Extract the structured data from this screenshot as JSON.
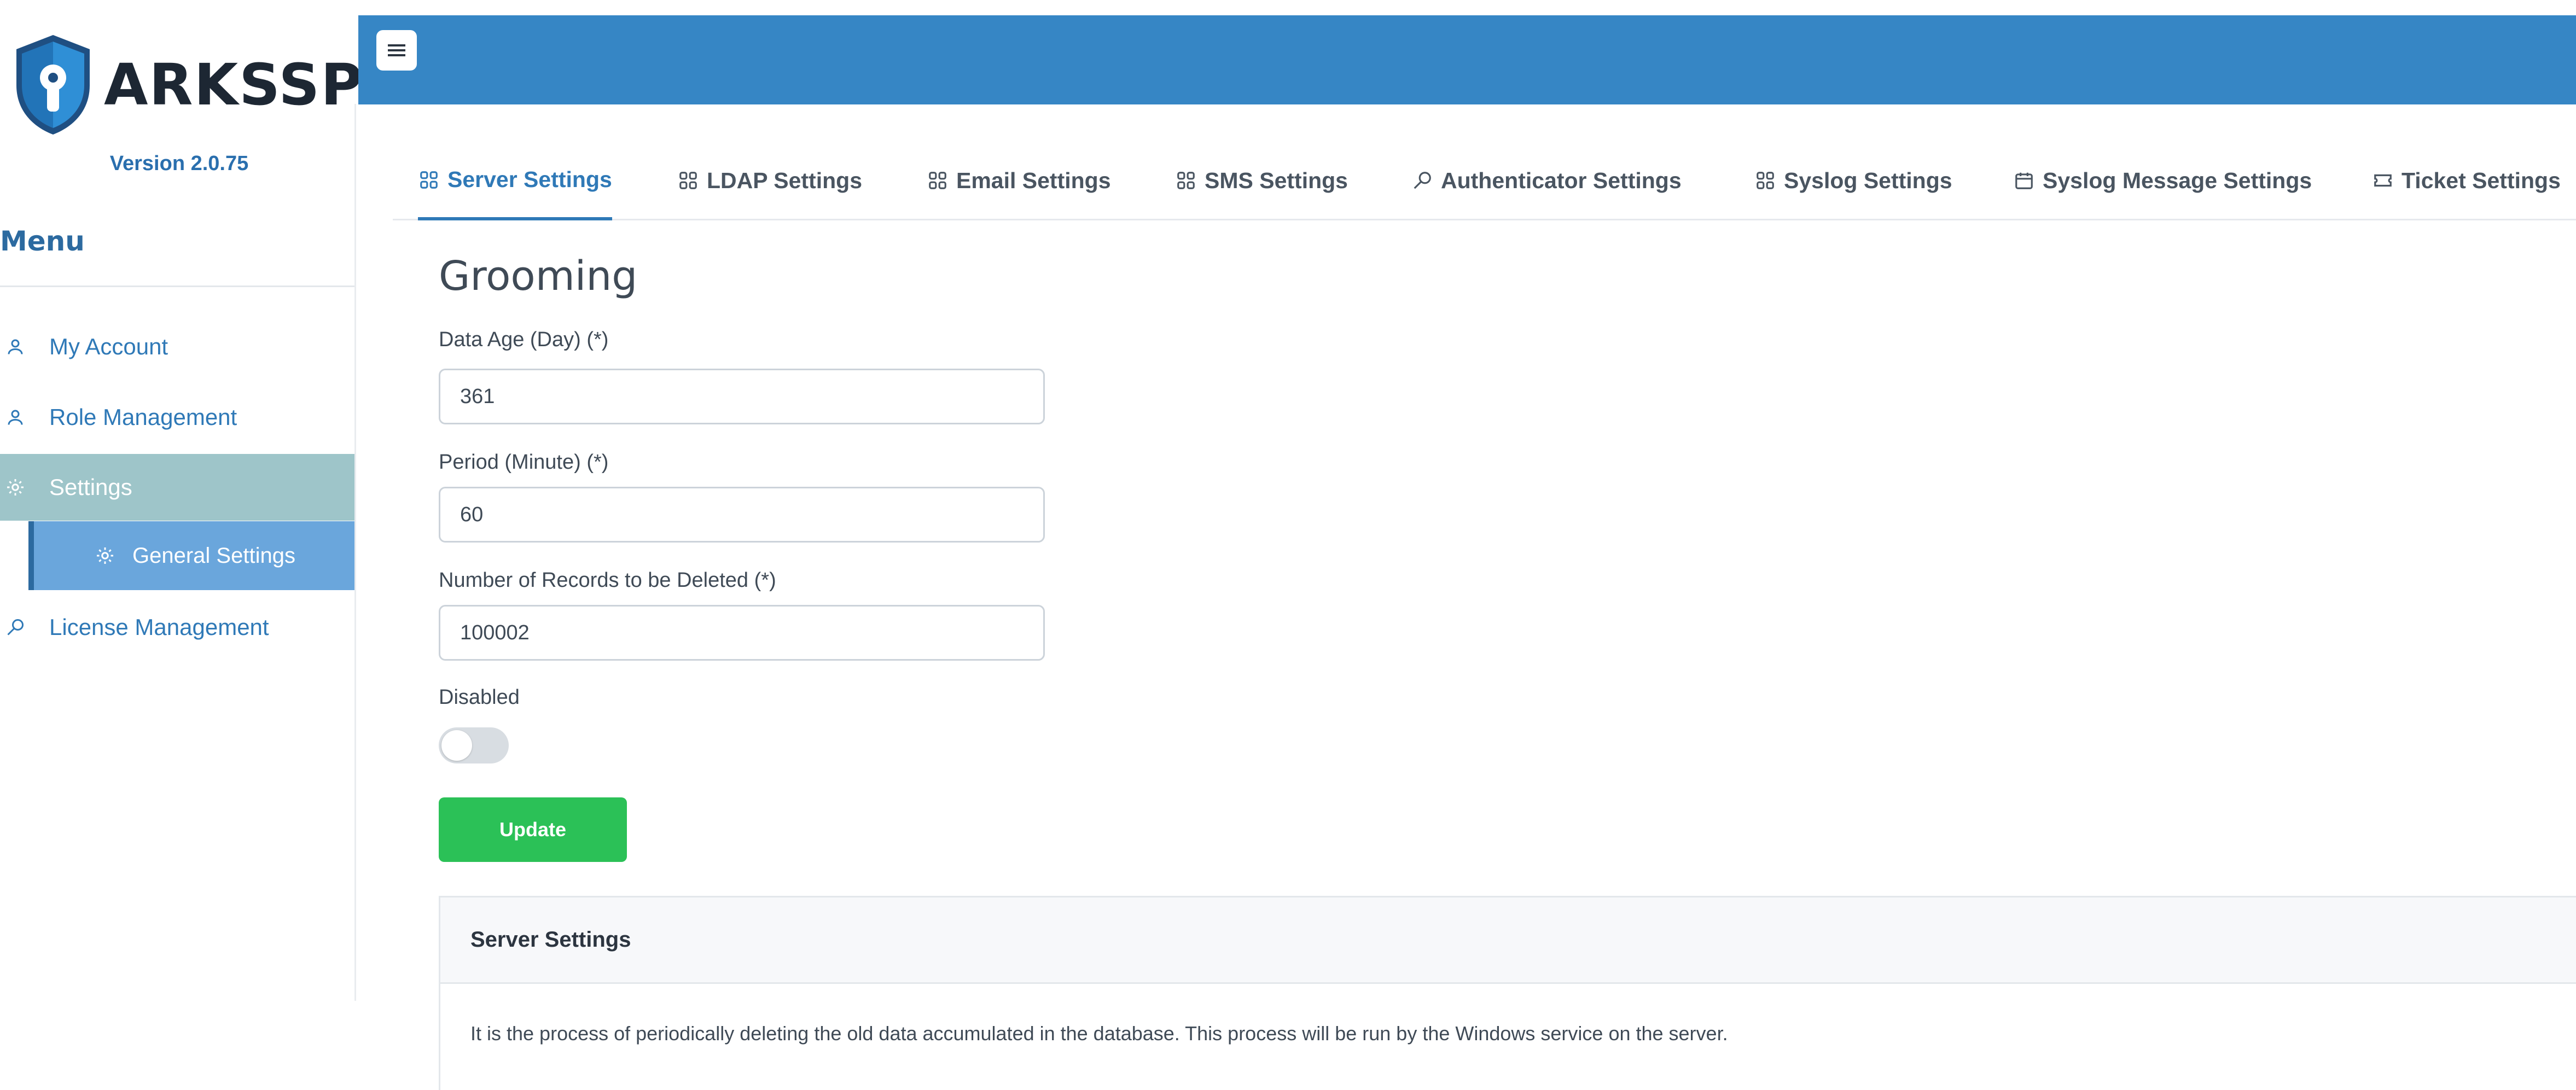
{
  "app": {
    "name": "ARKSSPR",
    "version": "Version 2.0.75"
  },
  "sidebar": {
    "menu_title": "Menu",
    "items": [
      {
        "label": "My Account",
        "icon": "user-icon"
      },
      {
        "label": "Role Management",
        "icon": "user-icon"
      },
      {
        "label": "Settings",
        "icon": "gear-icon",
        "active": true
      },
      {
        "label": "General Settings",
        "icon": "gear-icon",
        "sub": true,
        "active": true
      },
      {
        "label": "License Management",
        "icon": "key-icon"
      }
    ]
  },
  "tabs": [
    {
      "label": "Server Settings",
      "icon": "grid-icon",
      "active": true
    },
    {
      "label": "LDAP Settings",
      "icon": "grid-icon"
    },
    {
      "label": "Email Settings",
      "icon": "grid-icon"
    },
    {
      "label": "SMS Settings",
      "icon": "grid-icon"
    },
    {
      "label": "Authenticator Settings",
      "icon": "key-icon"
    },
    {
      "label": "Syslog Settings",
      "icon": "grid-icon"
    },
    {
      "label": "Syslog Message Settings",
      "icon": "calendar-icon"
    },
    {
      "label": "Ticket Settings",
      "icon": "ticket-icon"
    }
  ],
  "form": {
    "title": "Grooming",
    "data_age": {
      "label": "Data Age (Day) (*)",
      "value": "361"
    },
    "period": {
      "label": "Period (Minute) (*)",
      "value": "60"
    },
    "records": {
      "label": "Number of Records to be Deleted (*)",
      "value": "100002"
    },
    "disabled": {
      "label": "Disabled",
      "checked": false
    },
    "update_label": "Update"
  },
  "info_card": {
    "title": "Server Settings",
    "body": "It is the process of periodically deleting the old data accumulated in the database. This process will be run by the Windows service on the server."
  },
  "colors": {
    "topbar": "#3686c5",
    "accent": "#2f79b7",
    "active_menu": "#9ec5c9",
    "sub_menu": "#6aa6dc",
    "update_button": "#2bc157"
  }
}
